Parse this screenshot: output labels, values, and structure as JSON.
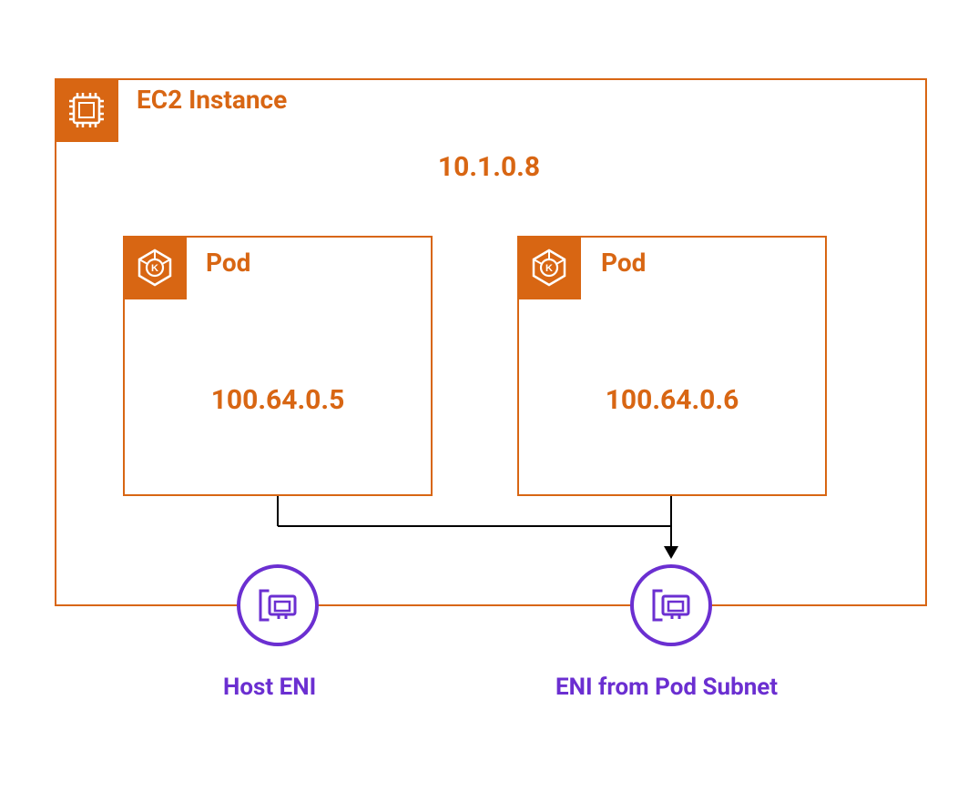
{
  "colors": {
    "aws_orange": "#d86613",
    "aws_purple": "#6b2fd1"
  },
  "ec2": {
    "title": "EC2 Instance",
    "ip": "10.1.0.8",
    "icon": "ec2-chip-icon"
  },
  "pods": [
    {
      "title": "Pod",
      "ip": "100.64.0.5",
      "icon": "kubernetes-pod-icon"
    },
    {
      "title": "Pod",
      "ip": "100.64.0.6",
      "icon": "kubernetes-pod-icon"
    }
  ],
  "enis": [
    {
      "label": "Host ENI",
      "icon": "eni-icon"
    },
    {
      "label": "ENI from Pod Subnet",
      "icon": "eni-icon"
    }
  ],
  "connector": {
    "from": "pods",
    "to": "eni-from-pod-subnet",
    "arrow": true
  }
}
